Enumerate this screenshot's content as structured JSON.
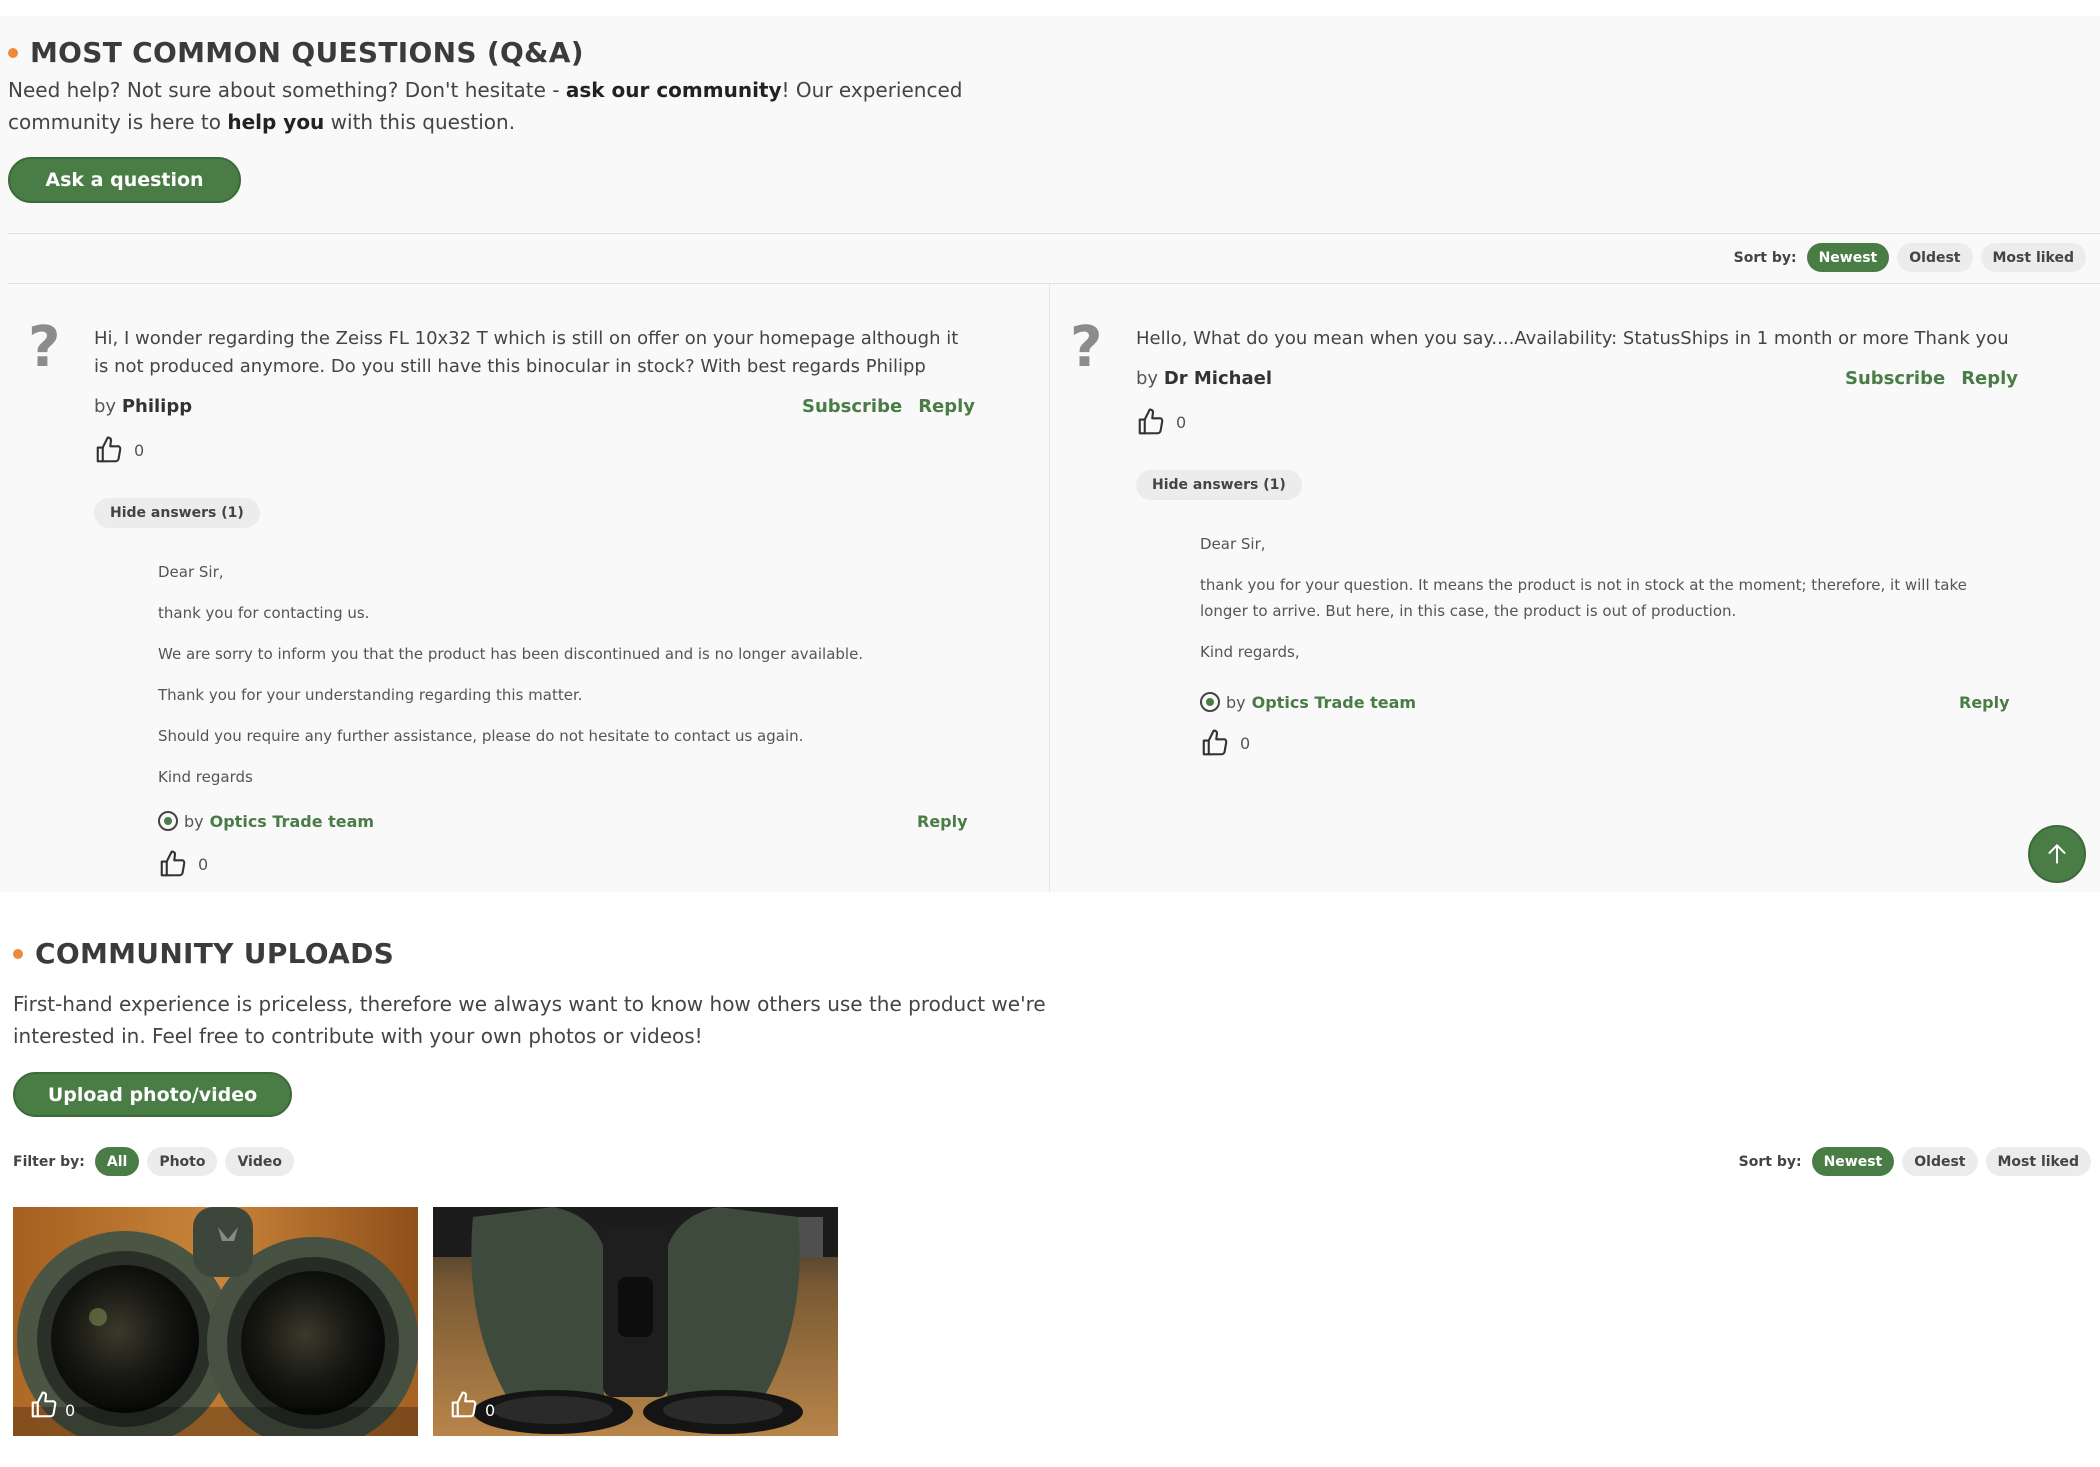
{
  "qa": {
    "title": "MOST COMMON QUESTIONS (Q&A)",
    "intro": {
      "p1": "Need help? Not sure about something? Don't hesitate - ",
      "b1": "ask our community",
      "p2": "! Our experienced",
      "p3": "community is here to ",
      "b2": "help you",
      "p4": " with this question."
    },
    "ask_button": "Ask a question",
    "sort": {
      "label": "Sort by:",
      "options": [
        "Newest",
        "Oldest",
        "Most liked"
      ],
      "active": "Newest"
    },
    "questions": [
      {
        "text": "Hi, I wonder regarding the Zeiss FL 10x32 T which is still on offer on your homepage although it is not produced anymore. Do you still have this binocular in stock? With best regards Philipp",
        "by_prefix": "by",
        "author": "Philipp",
        "subscribe": "Subscribe",
        "reply": "Reply",
        "likes": "0",
        "toggle_answers": "Hide answers (1)",
        "answer": {
          "paragraphs": [
            "Dear Sir,",
            "thank you for contacting us.",
            "We are sorry to inform you that the product has been discontinued and is no longer available.",
            "Thank you for your understanding regarding this matter.",
            "Should you require any further assistance, please do not hesitate to contact us again.",
            "Kind regards"
          ],
          "by_prefix": "by",
          "author": "Optics Trade team",
          "reply": "Reply",
          "likes": "0"
        }
      },
      {
        "text": "Hello, What do you mean when you say....Availability: StatusShips in 1 month or more Thank you",
        "by_prefix": "by",
        "author": "Dr Michael",
        "subscribe": "Subscribe",
        "reply": "Reply",
        "likes": "0",
        "toggle_answers": "Hide answers (1)",
        "answer": {
          "paragraphs": [
            "Dear Sir,",
            "thank you for your question. It means the product is not in stock at the moment; therefore, it will take longer to arrive. But here, in this case, the product is out of production.",
            "Kind regards,"
          ],
          "by_prefix": "by",
          "author": "Optics Trade team",
          "reply": "Reply",
          "likes": "0"
        }
      }
    ]
  },
  "uploads": {
    "title": "COMMUNITY UPLOADS",
    "intro_line1": "First-hand experience is priceless, therefore we always want to know how others use the product we're",
    "intro_line2": "interested in. Feel free to contribute with your own photos or videos!",
    "upload_button": "Upload photo/video",
    "filter": {
      "label": "Filter by:",
      "options": [
        "All",
        "Photo",
        "Video"
      ],
      "active": "All"
    },
    "sort": {
      "label": "Sort by:",
      "options": [
        "Newest",
        "Oldest",
        "Most liked"
      ],
      "active": "Newest"
    },
    "items": [
      {
        "likes": "0"
      },
      {
        "likes": "0"
      }
    ]
  },
  "colors": {
    "accent": "#4a7c46",
    "bullet": "#ef8a3b",
    "panel_bg": "#f9f9f9"
  },
  "icons": {
    "like": "thumbs-up-icon",
    "question": "question-mark-icon",
    "team": "team-badge-icon",
    "scroll": "arrow-up-icon"
  }
}
